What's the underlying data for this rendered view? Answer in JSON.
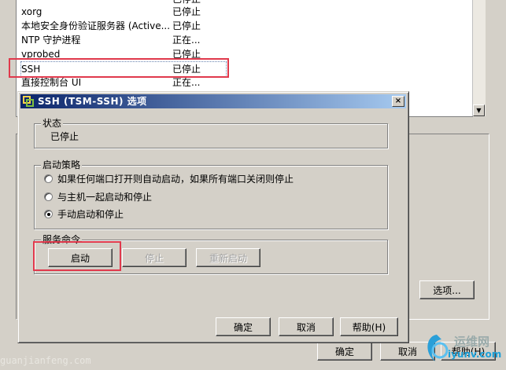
{
  "services": [
    {
      "name": "",
      "status": "已停止",
      "partial": true
    },
    {
      "name": "xorg",
      "status": "已停止"
    },
    {
      "name": "本地安全身份验证服务器 (Active...",
      "status": "已停止"
    },
    {
      "name": "NTP 守护进程",
      "status": "正在..."
    },
    {
      "name": "vprobed",
      "status": "已停止"
    },
    {
      "name": "SSH",
      "status": "已停止",
      "selected": true
    },
    {
      "name": "直接控制台 UI",
      "status": "正在..."
    }
  ],
  "outer": {
    "options_button": "选项...",
    "ok_button": "确定",
    "cancel_button": "取消",
    "help_button": "帮助(H)"
  },
  "dialog": {
    "title": "SSH (TSM-SSH) 选项",
    "close_glyph": "×",
    "status_group": {
      "legend": "状态",
      "value": "已停止"
    },
    "policy_group": {
      "legend": "启动策略",
      "options": [
        {
          "label": "如果任何端口打开则自动启动，如果所有端口关闭则停止",
          "checked": false
        },
        {
          "label": "与主机一起启动和停止",
          "checked": false
        },
        {
          "label": "手动启动和停止",
          "checked": true
        }
      ]
    },
    "command_group": {
      "legend": "服务命令",
      "start": "启动",
      "stop": "停止",
      "restart": "重新启动"
    },
    "ok_button": "确定",
    "cancel_button": "取消",
    "help_button": "帮助(H)"
  },
  "watermark": "guanjianfeng.com",
  "logo": {
    "line1": "运维网",
    "line2": "iyunv.com"
  },
  "colors": {
    "titlebar_start": "#0a246a",
    "titlebar_end": "#a6caf0",
    "highlight": "#e0394c",
    "window_bg": "#d4d0c8"
  }
}
